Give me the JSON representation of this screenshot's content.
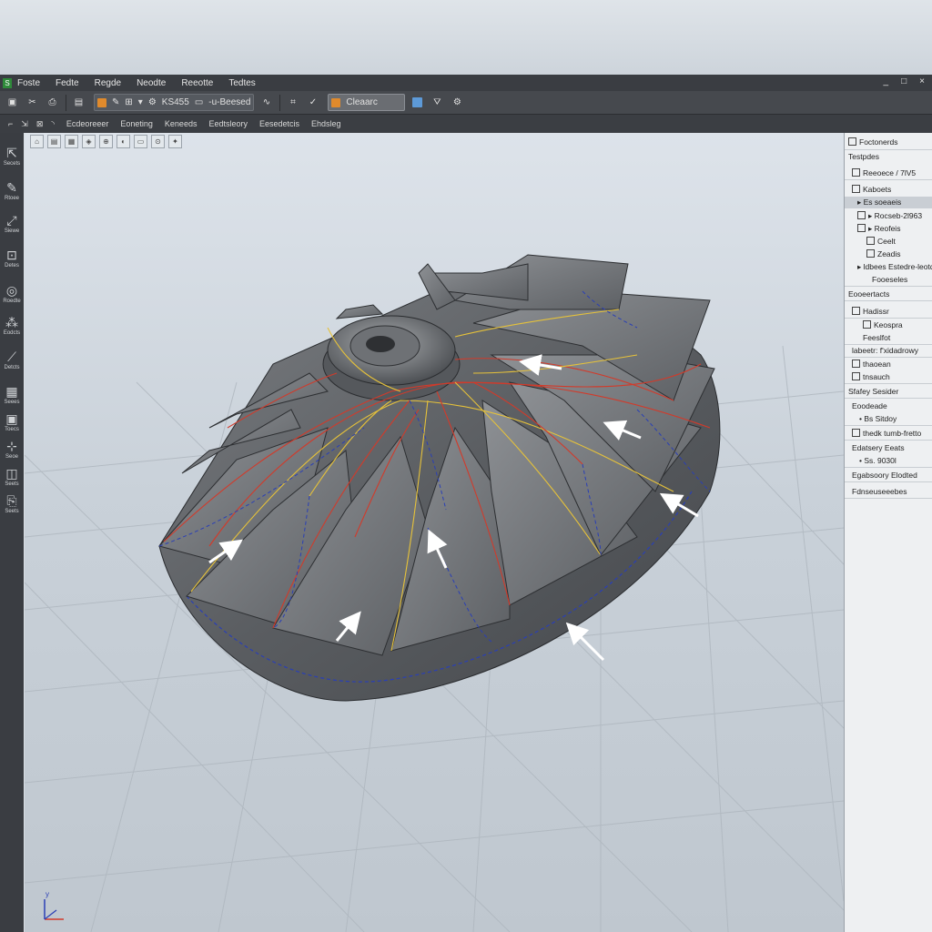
{
  "menu": {
    "items": [
      "Foste",
      "Fedte",
      "Regde",
      "Neodte",
      "Reeotte",
      "Tedtes"
    ],
    "window_controls": [
      "_",
      "□",
      "×"
    ]
  },
  "toolbar": {
    "combo1_label": "KS455",
    "combo2_label": "-u-Beesed",
    "combo3_label": "Cleaarc"
  },
  "subtoolbar": {
    "labels": [
      "Ecdeoreeer",
      "Eoneting",
      "Keneeds",
      "Eedtsleory",
      "Eesedetcis",
      "Ehdsleg"
    ]
  },
  "leftbar": {
    "items": [
      {
        "icon": "select-icon",
        "label": "Secets"
      },
      {
        "icon": "sketch-icon",
        "label": "Rtoee"
      },
      {
        "icon": "extrude-icon",
        "label": "Siewe"
      },
      {
        "icon": "revolve-icon",
        "label": "Detes"
      },
      {
        "icon": "fillet-icon",
        "label": "Roedte"
      },
      {
        "icon": "pattern-icon",
        "label": "Eodcts"
      },
      {
        "icon": "mirror-icon",
        "label": "Detcts"
      },
      {
        "icon": "mesh-icon",
        "label": "Seees"
      },
      {
        "icon": "shell-icon",
        "label": "Toecs"
      },
      {
        "icon": "assembly-icon",
        "label": "Seoe"
      },
      {
        "icon": "measure-icon",
        "label": "Seets"
      },
      {
        "icon": "export-icon",
        "label": "Seets"
      }
    ]
  },
  "panel": {
    "header": "Foctonerds",
    "rows": [
      {
        "text": "Testpdes",
        "indent": 4
      },
      {
        "text": "Reeoece / 7lV5",
        "indent": 8,
        "check": true
      },
      {
        "text": "Kaboets",
        "indent": 8,
        "check": true
      },
      {
        "text": "▸ Es soeaeis",
        "indent": 14,
        "selected": true
      },
      {
        "text": "▸ Rocseb-2l963",
        "indent": 14,
        "check": true
      },
      {
        "text": "▸ Reofeis",
        "indent": 14,
        "check": true
      },
      {
        "text": "Ceelt",
        "indent": 24,
        "check": true
      },
      {
        "text": "Zeadis",
        "indent": 24,
        "check": true
      },
      {
        "text": "▸ ldbees Estedre-leotd",
        "indent": 14
      },
      {
        "text": "Fooeseles",
        "indent": 30
      },
      {
        "text": "Eooeertacts",
        "indent": 4
      },
      {
        "text": "Hadissr",
        "indent": 8,
        "check": true
      },
      {
        "text": "Keospra",
        "indent": 20,
        "check": true
      },
      {
        "text": "Feeslfot",
        "indent": 20
      },
      {
        "text": "labeetr: f'xidadrowy",
        "indent": 8
      },
      {
        "text": "thaoean",
        "indent": 8,
        "check": true
      },
      {
        "text": "tnsauch",
        "indent": 8,
        "check": true
      },
      {
        "text": "Sfafey Sesider",
        "indent": 4
      },
      {
        "text": "Eoodeade",
        "indent": 8
      },
      {
        "text": "• Bs Sitdoy",
        "indent": 16
      },
      {
        "text": "thedk tumb-fretto",
        "indent": 8,
        "check": true
      },
      {
        "text": "Edatsery Eeats",
        "indent": 8
      },
      {
        "text": "• Ss. 9030l",
        "indent": 16
      },
      {
        "text": "Egabsoory Elodted",
        "indent": 8
      },
      {
        "text": "Fdnseuseeebes",
        "indent": 8
      }
    ]
  },
  "viewport": {
    "axis_y_label": "y",
    "model": "impeller"
  },
  "colors": {
    "accent_orange": "#e08a2c",
    "curve_red": "#d23a2a",
    "curve_yellow": "#e6c23a",
    "curve_blue": "#2a3fb5"
  }
}
